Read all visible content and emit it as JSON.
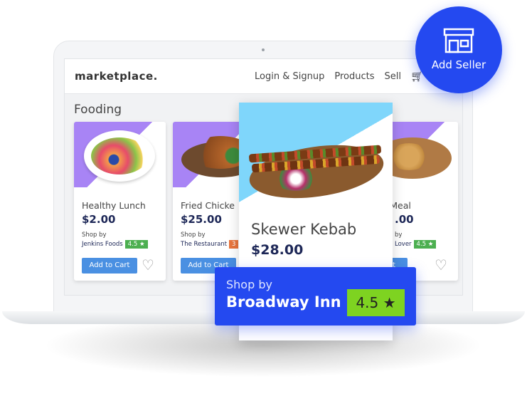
{
  "header": {
    "logo": "marketplace.",
    "nav": [
      "Login & Signup",
      "Products",
      "Sell"
    ],
    "cart_icon": "shopping-cart-icon"
  },
  "section_title": "Fooding",
  "cards": [
    {
      "title": "Healthy Lunch",
      "price": "$2.00",
      "shop_by": "Shop by",
      "shop": "Jenkins Foods",
      "rating": "4.5 ★",
      "add": "Add to Cart"
    },
    {
      "title": "Fried Chicke",
      "price": "$25.00",
      "shop_by": "Shop by",
      "shop": "The Restaurant",
      "rating": "3",
      "add": "Add to Cart"
    },
    {
      "title": "cken Meal",
      "price": ".00",
      "shop_by": "by",
      "shop": "Lover",
      "rating": "4.5 ★",
      "add": "d to Cart"
    }
  ],
  "featured": {
    "title": "Skewer Kebab",
    "price": "$28.00",
    "shop_by": "Shop by",
    "shop": "Broadway Inn",
    "rating": "4.5 ★"
  },
  "add_seller": {
    "label": "Add Seller",
    "icon": "store-icon"
  },
  "colors": {
    "accent": "#2449f0",
    "purple": "#a884f5",
    "light_blue": "#7fd6fb",
    "green": "#4caf50",
    "button": "#4a90e2"
  }
}
